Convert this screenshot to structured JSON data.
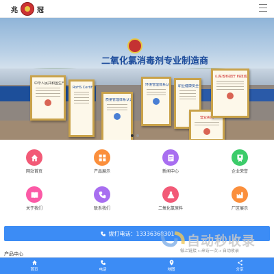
{
  "header": {
    "logo_char_left": "兆",
    "logo_char_right": "冠"
  },
  "banner": {
    "title": "二氧化氯消毒剂专业制造商",
    "certificates": [
      "中华人民共和国生产许可证",
      "RoHS Certificate of Compliance",
      "质量管理体系认证证书",
      "环境管理体系认证证书",
      "职业健康安全管理体系认证证书",
      "营业执照",
      "山东省科技厅 科技成果证书"
    ],
    "page_dots": 2,
    "active_dot": 0
  },
  "menu": {
    "items": [
      {
        "label": "网站首页",
        "icon": "home-icon",
        "color": "#f25a77"
      },
      {
        "label": "产品展示",
        "icon": "grid-icon",
        "color": "#fb8f3c"
      },
      {
        "label": "新闻中心",
        "icon": "news-icon",
        "color": "#a86ef0"
      },
      {
        "label": "企业荣誉",
        "icon": "award-icon",
        "color": "#3ccc6a"
      },
      {
        "label": "关于我们",
        "icon": "book-icon",
        "color": "#fb5aa6"
      },
      {
        "label": "联系我们",
        "icon": "phone-icon",
        "color": "#a86ef0"
      },
      {
        "label": "二氧化氯原料",
        "icon": "flask-icon",
        "color": "#f25a77"
      },
      {
        "label": "厂区展示",
        "icon": "factory-icon",
        "color": "#fb8f3c"
      }
    ]
  },
  "phone_bar": {
    "label": "拨打电话：",
    "number": "13336368301"
  },
  "products_section": {
    "title": "产品中心"
  },
  "watermark": {
    "text": "自动秒收录",
    "sub": "做上链接 ←来访一次→ 自动收录"
  },
  "bottom_nav": [
    {
      "label": "首页",
      "icon": "home-icon"
    },
    {
      "label": "电话",
      "icon": "phone-icon"
    },
    {
      "label": "地图",
      "icon": "map-pin-icon"
    },
    {
      "label": "分享",
      "icon": "share-icon"
    }
  ],
  "colors": {
    "accent": "#3c8cf5"
  }
}
